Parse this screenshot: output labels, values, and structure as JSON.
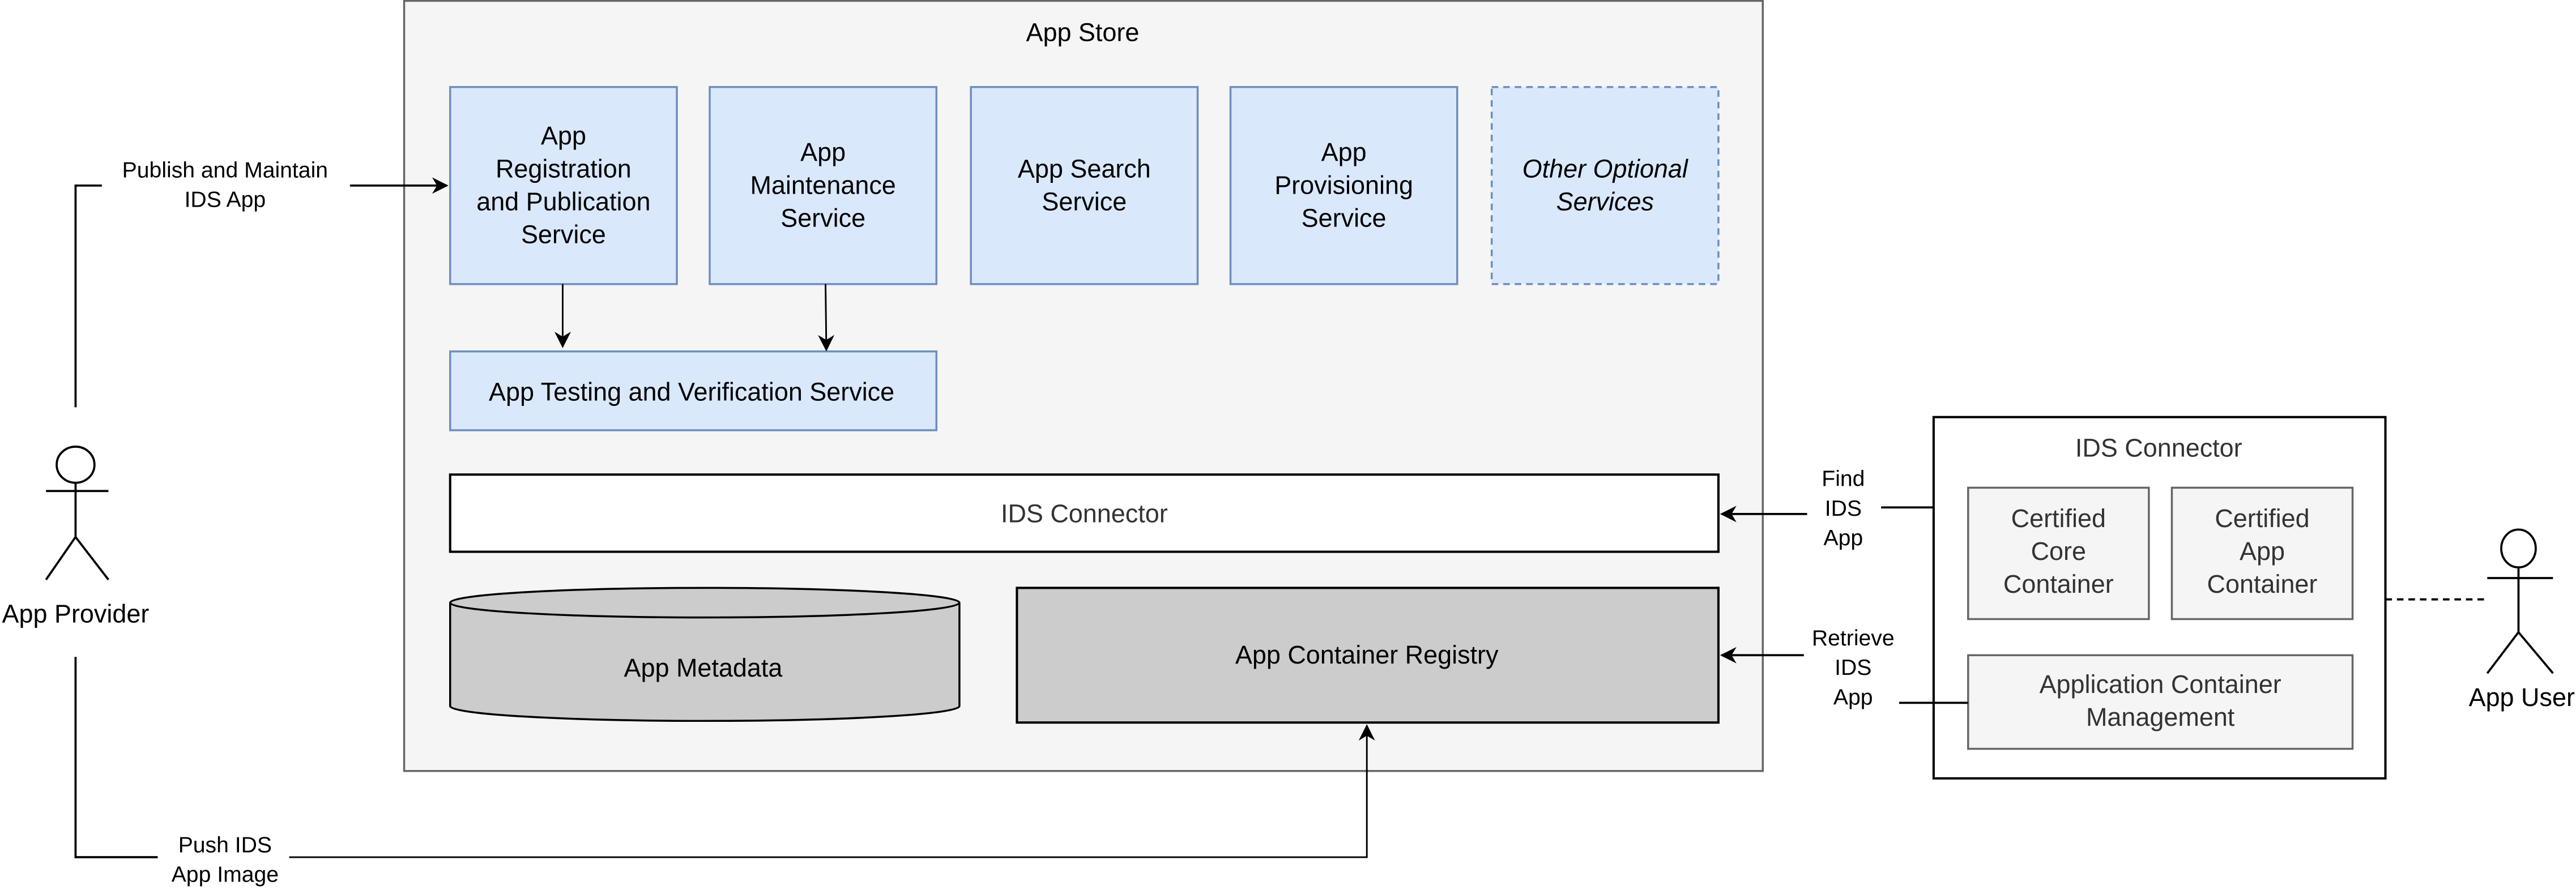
{
  "diagram": {
    "app_store": {
      "title": "App Store",
      "services": [
        {
          "lines": [
            "App",
            "Registration",
            "and Publication",
            "Service"
          ],
          "optional": false
        },
        {
          "lines": [
            "App",
            "Maintenance",
            "Service"
          ],
          "optional": false
        },
        {
          "lines": [
            "App Search",
            "Service"
          ],
          "optional": false
        },
        {
          "lines": [
            "App",
            "Provisioning",
            "Service"
          ],
          "optional": false
        },
        {
          "lines": [
            "Other Optional",
            "Services"
          ],
          "optional": true
        }
      ],
      "testing_service": "App Testing and Verification Service",
      "ids_connector": "IDS Connector",
      "app_metadata": "App Metadata",
      "container_registry": "App Container Registry"
    },
    "external_connector": {
      "title": "IDS Connector",
      "certified_core": [
        "Certified",
        "Core",
        "Container"
      ],
      "certified_app": [
        "Certified",
        "App",
        "Container"
      ],
      "container_management": [
        "Application Container",
        "Management"
      ]
    },
    "actors": {
      "provider": "App Provider",
      "user": "App User"
    },
    "edge_labels": {
      "publish": [
        "Publish and Maintain",
        "IDS App"
      ],
      "push": [
        "Push IDS",
        "App Image"
      ],
      "find": [
        "Find",
        "IDS",
        "App"
      ],
      "retrieve": [
        "Retrieve",
        "IDS",
        "App"
      ]
    },
    "colors": {
      "service_fill": "#dae8fc",
      "service_stroke": "#6c8ebf",
      "store_fill": "#f5f5f5",
      "store_stroke": "#666666",
      "storage_fill": "#cccccc",
      "text_dark": "#000000",
      "text_gray": "#333333"
    }
  }
}
